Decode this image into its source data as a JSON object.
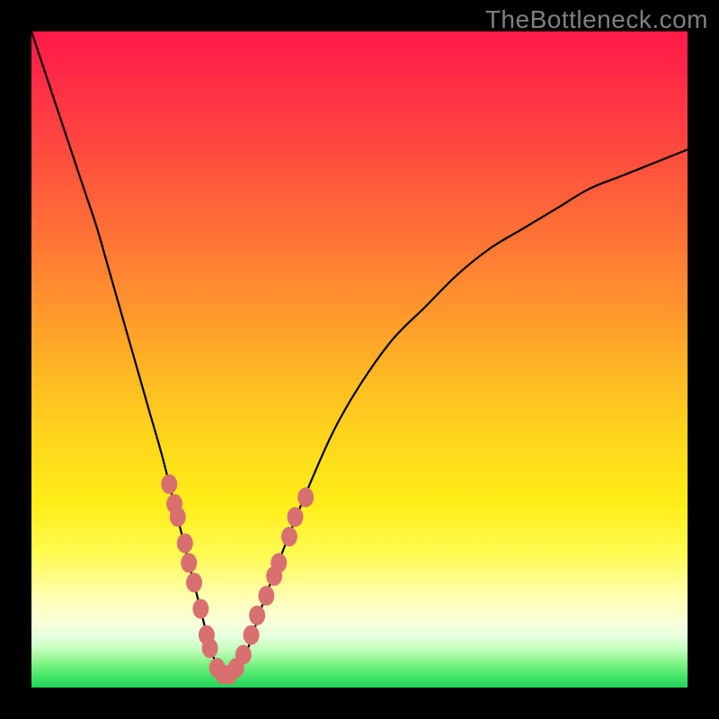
{
  "watermark": "TheBottleneck.com",
  "colors": {
    "marker_fill": "#d97070",
    "curve_stroke": "#000000",
    "gradient_top": "#ff1a47",
    "gradient_bottom": "#1fd45a",
    "background": "#000000"
  },
  "chart_data": {
    "type": "line",
    "title": "",
    "xlabel": "",
    "ylabel": "",
    "xlim": [
      0,
      100
    ],
    "ylim": [
      0,
      100
    ],
    "x": [
      0,
      2,
      4,
      6,
      8,
      10,
      12,
      14,
      16,
      18,
      20,
      22,
      24,
      26,
      27,
      28,
      29,
      30,
      31,
      33,
      35,
      38,
      42,
      46,
      50,
      55,
      60,
      65,
      70,
      75,
      80,
      85,
      90,
      95,
      100
    ],
    "values": [
      100,
      94,
      88,
      82,
      76,
      70,
      63,
      56,
      49,
      42,
      35,
      27,
      19,
      11,
      7,
      4,
      2,
      1,
      2,
      6,
      12,
      20,
      30,
      39,
      46,
      53,
      58,
      63,
      67,
      70,
      73,
      76,
      78,
      80,
      82
    ],
    "marker_points": [
      {
        "x": 21.0,
        "y": 31
      },
      {
        "x": 21.8,
        "y": 28
      },
      {
        "x": 22.3,
        "y": 26
      },
      {
        "x": 23.4,
        "y": 22
      },
      {
        "x": 24.0,
        "y": 19
      },
      {
        "x": 24.8,
        "y": 16
      },
      {
        "x": 25.8,
        "y": 12
      },
      {
        "x": 26.7,
        "y": 8
      },
      {
        "x": 27.2,
        "y": 6
      },
      {
        "x": 28.3,
        "y": 3
      },
      {
        "x": 29.2,
        "y": 2
      },
      {
        "x": 30.2,
        "y": 2
      },
      {
        "x": 31.2,
        "y": 3
      },
      {
        "x": 32.3,
        "y": 5
      },
      {
        "x": 33.5,
        "y": 8
      },
      {
        "x": 34.4,
        "y": 11
      },
      {
        "x": 35.8,
        "y": 14
      },
      {
        "x": 37.0,
        "y": 17
      },
      {
        "x": 37.7,
        "y": 19
      },
      {
        "x": 39.3,
        "y": 23
      },
      {
        "x": 40.2,
        "y": 26
      },
      {
        "x": 41.8,
        "y": 29
      }
    ]
  }
}
